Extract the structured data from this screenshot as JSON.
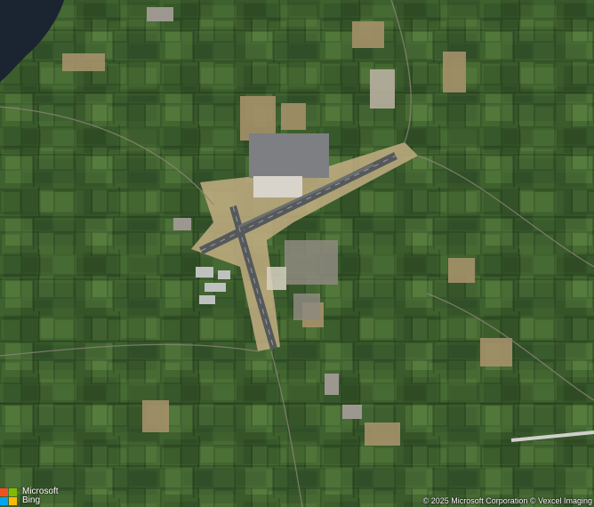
{
  "map": {
    "type": "satellite",
    "colors": {
      "field_dark": "#2c4a22",
      "field_mid": "#3d5e2c",
      "field_light": "#567a3a",
      "field_tan": "#a89468",
      "water": "#1a2230",
      "runway": "#555a5c",
      "apron": "#c9b48a"
    }
  },
  "attribution": {
    "brand_line1": "Microsoft",
    "brand_line2": "Bing",
    "logo_colors": [
      "#f25022",
      "#7fba00",
      "#00a4ef",
      "#ffb900"
    ],
    "copyright": "© 2025 Microsoft Corporation © Vexcel Imaging"
  }
}
